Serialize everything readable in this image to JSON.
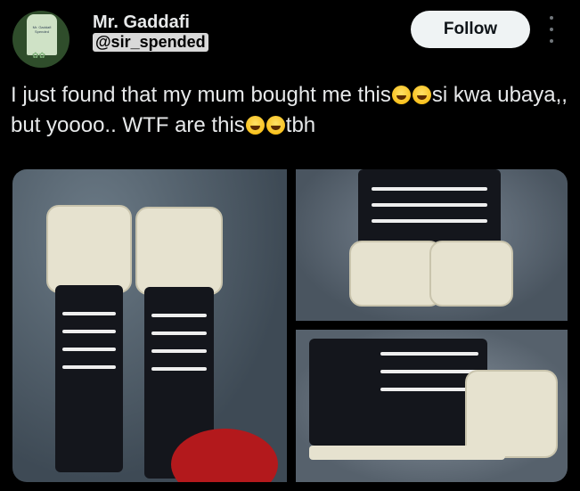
{
  "user": {
    "name": "Mr. Gaddafi",
    "handle": "@sir_spended",
    "avatar_text": "Mr. Gaddafi Spended"
  },
  "actions": {
    "follow_label": "Follow"
  },
  "tweet": {
    "part1": "I just found that my mum bought me this",
    "part2": "si kwa ubaya,, but yoooo.. WTF are this",
    "part3": "tbh"
  },
  "icons": {
    "more": "more-vertical-icon",
    "emoji": "face-with-tears-of-joy-icon"
  },
  "colors": {
    "background": "#000000",
    "follow_bg": "#eff3f4",
    "text": "#e7e9ea"
  }
}
